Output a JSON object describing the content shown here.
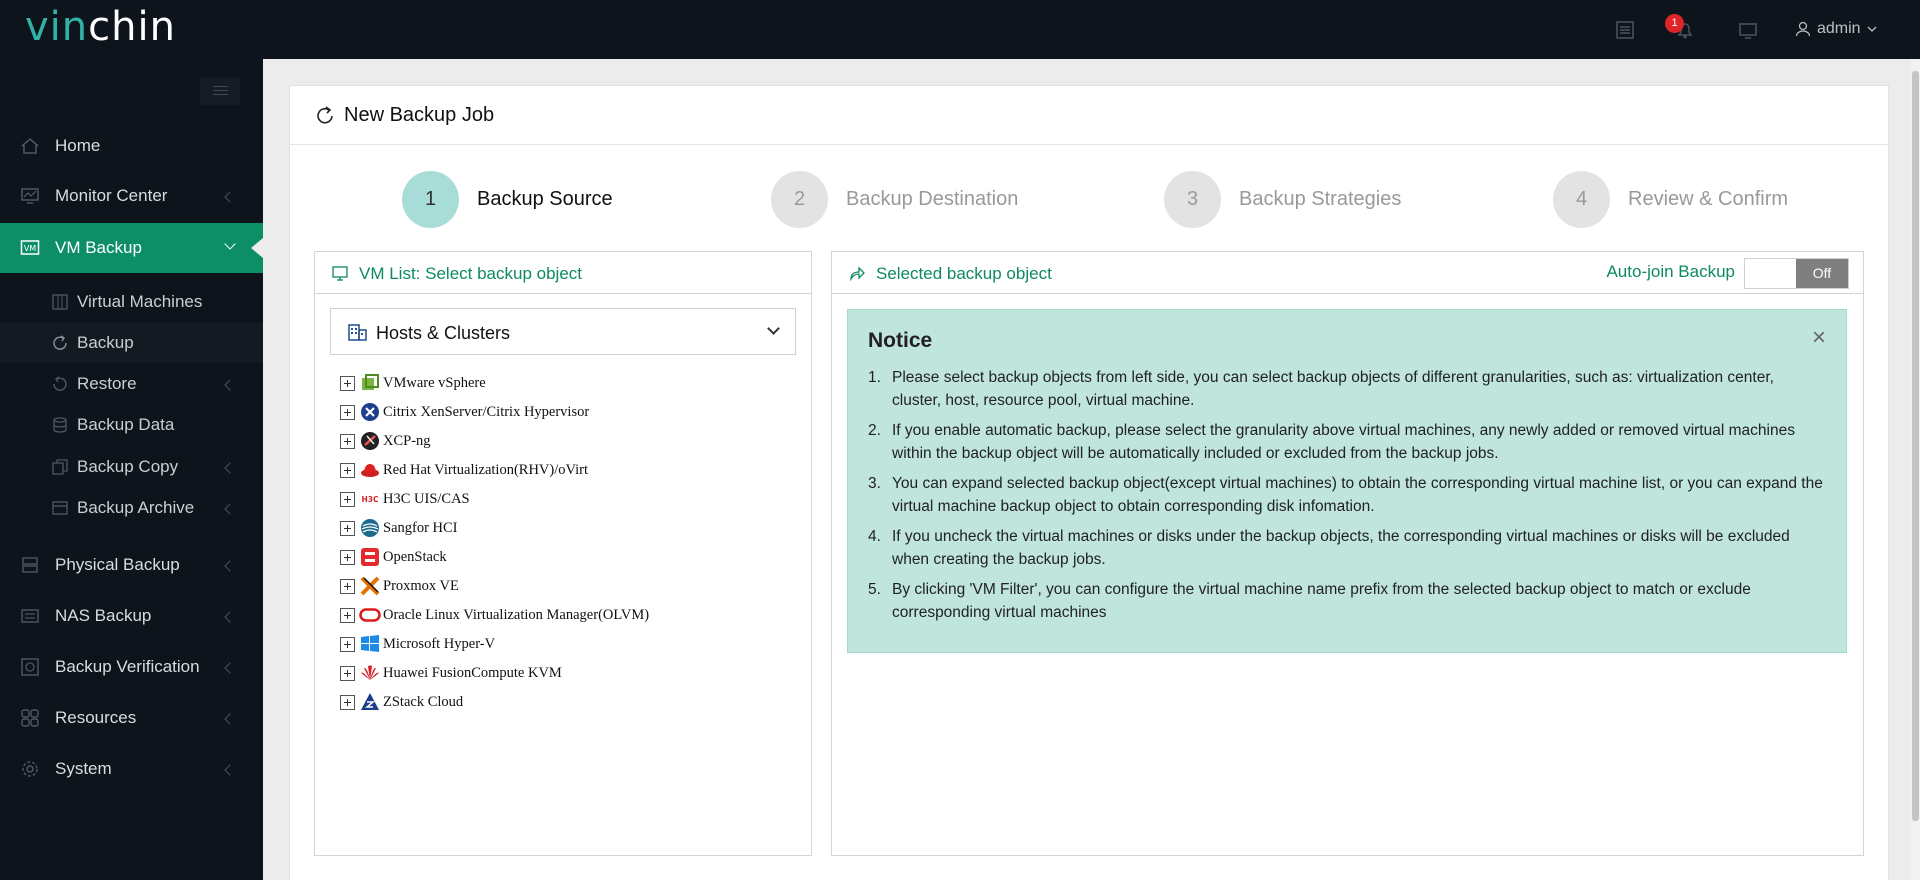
{
  "app": {
    "logo_prefix": "vin",
    "logo_suffix": "chin",
    "notification_count": "1",
    "user": "admin"
  },
  "sidebar": {
    "items": [
      {
        "label": "Home",
        "icon": "home-icon"
      },
      {
        "label": "Monitor Center",
        "icon": "monitor-icon"
      },
      {
        "label": "VM Backup",
        "icon": "vm-icon"
      },
      {
        "label": "Physical Backup",
        "icon": "server-icon"
      },
      {
        "label": "NAS Backup",
        "icon": "nas-icon"
      },
      {
        "label": "Backup Verification",
        "icon": "verify-icon"
      },
      {
        "label": "Resources",
        "icon": "resources-icon"
      },
      {
        "label": "System",
        "icon": "gear-icon"
      }
    ],
    "sub_items": [
      {
        "label": "Virtual Machines",
        "icon": "grid-icon"
      },
      {
        "label": "Backup",
        "icon": "refresh-icon"
      },
      {
        "label": "Restore",
        "icon": "restore-icon"
      },
      {
        "label": "Backup Data",
        "icon": "database-icon"
      },
      {
        "label": "Backup Copy",
        "icon": "copy-icon"
      },
      {
        "label": "Backup Archive",
        "icon": "archive-icon"
      }
    ]
  },
  "page": {
    "title": "New Backup Job"
  },
  "steps": [
    {
      "num": "1",
      "label": "Backup Source"
    },
    {
      "num": "2",
      "label": "Backup Destination"
    },
    {
      "num": "3",
      "label": "Backup Strategies"
    },
    {
      "num": "4",
      "label": "Review & Confirm"
    }
  ],
  "left_panel": {
    "title": "VM List: Select backup object",
    "dropdown_value": "Hosts & Clusters",
    "tree": [
      {
        "label": "VMware vSphere",
        "icon": "vmware-icon"
      },
      {
        "label": "Citrix XenServer/Citrix Hypervisor",
        "icon": "citrix-icon"
      },
      {
        "label": "XCP-ng",
        "icon": "xcpng-icon"
      },
      {
        "label": "Red Hat Virtualization(RHV)/oVirt",
        "icon": "redhat-icon"
      },
      {
        "label": "H3C UIS/CAS",
        "icon": "h3c-icon"
      },
      {
        "label": "Sangfor HCI",
        "icon": "sangfor-icon"
      },
      {
        "label": "OpenStack",
        "icon": "openstack-icon"
      },
      {
        "label": "Proxmox VE",
        "icon": "proxmox-icon"
      },
      {
        "label": "Oracle Linux Virtualization Manager(OLVM)",
        "icon": "oracle-icon"
      },
      {
        "label": "Microsoft Hyper-V",
        "icon": "windows-icon"
      },
      {
        "label": "Huawei FusionCompute KVM",
        "icon": "huawei-icon"
      },
      {
        "label": "ZStack Cloud",
        "icon": "zstack-icon"
      }
    ]
  },
  "right_panel": {
    "title": "Selected backup object",
    "auto_join_label": "Auto-join Backup",
    "toggle_state": "Off",
    "notice": {
      "title": "Notice",
      "close": "×",
      "items": [
        {
          "num": "1.",
          "text": "Please select backup objects from left side, you can select backup objects of different granularities, such as: virtualization center, cluster, host, resource pool, virtual machine."
        },
        {
          "num": "2.",
          "text": "If you enable automatic backup, please select the granularity above virtual machines, any newly added or removed virtual machines within the backup object will be automatically included or excluded from the backup jobs."
        },
        {
          "num": "3.",
          "text": "You can expand selected backup object(except virtual machines) to obtain the corresponding virtual machine list, or you can expand the virtual machine backup object to obtain corresponding disk infomation."
        },
        {
          "num": "4.",
          "text": "If you uncheck the virtual machines or disks under the backup objects, the corresponding virtual machines or disks will be excluded when creating the backup jobs."
        },
        {
          "num": "5.",
          "text": "By clicking 'VM Filter', you can configure the virtual machine name prefix from the selected backup object to match or exclude corresponding virtual machines"
        }
      ]
    }
  },
  "colors": {
    "brand_green": "#0c8f67",
    "logo_teal": "#2fb3a7",
    "notice_bg": "#bfe5dd",
    "active_step": "#a8dcd6",
    "badge_red": "#e0252a"
  }
}
